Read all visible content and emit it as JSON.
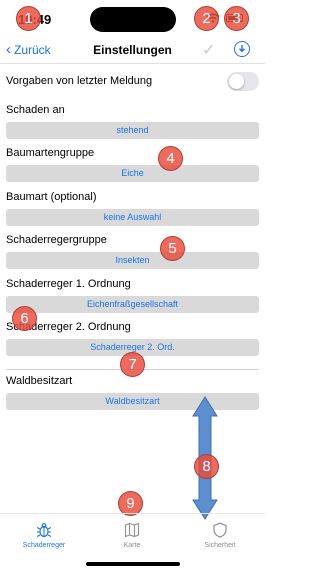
{
  "status_bar": {
    "time": "10:49"
  },
  "nav": {
    "back_label": "Zurück",
    "title": "Einstellungen"
  },
  "defaults_toggle": {
    "label": "Vorgaben von letzter Meldung",
    "on": false
  },
  "fields": [
    {
      "label": "Schaden an",
      "value": "stehend"
    },
    {
      "label": "Baumartengruppe",
      "value": "Eiche"
    },
    {
      "label": "Baumart (optional)",
      "value": "keine Auswahl"
    },
    {
      "label": "Schaderregergruppe",
      "value": "Insekten"
    },
    {
      "label": "Schaderreger 1. Ordnung",
      "value": "Eichenfraßgesellschaft"
    },
    {
      "label": "Schaderreger 2. Ordnung",
      "value": "Schaderreger 2. Ord."
    },
    {
      "label": "Waldbesitzart",
      "value": "Waldbesitzart"
    }
  ],
  "tabs": [
    {
      "label": "Schaderreger",
      "icon": "beetle-icon",
      "active": true
    },
    {
      "label": "Karte",
      "icon": "map-icon",
      "active": false
    },
    {
      "label": "Sicherheit",
      "icon": "shield-icon",
      "active": false
    }
  ],
  "annotations": [
    "1",
    "2",
    "3",
    "4",
    "5",
    "6",
    "7",
    "8",
    "9"
  ],
  "colors": {
    "accent": "#1a73e8",
    "button_bg": "#d9d9d9",
    "badge": "#e74c3c",
    "arrow": "#5b8fd0"
  }
}
